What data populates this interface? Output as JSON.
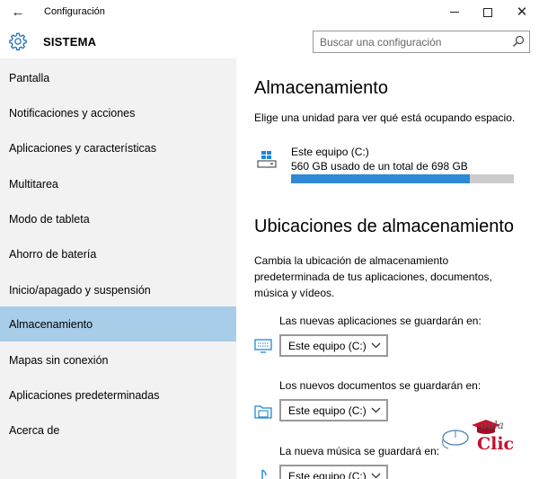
{
  "window": {
    "title": "Configuración"
  },
  "header": {
    "section_title": "SISTEMA",
    "search_placeholder": "Buscar una configuración"
  },
  "sidebar": {
    "items": [
      {
        "label": "Pantalla",
        "active": false
      },
      {
        "label": "Notificaciones y acciones",
        "active": false
      },
      {
        "label": "Aplicaciones y características",
        "active": false
      },
      {
        "label": "Multitarea",
        "active": false
      },
      {
        "label": "Modo de tableta",
        "active": false
      },
      {
        "label": "Ahorro de batería",
        "active": false
      },
      {
        "label": "Inicio/apagado y suspensión",
        "active": false
      },
      {
        "label": "Almacenamiento",
        "active": true
      },
      {
        "label": "Mapas sin conexión",
        "active": false
      },
      {
        "label": "Aplicaciones predeterminadas",
        "active": false
      },
      {
        "label": "Acerca de",
        "active": false
      }
    ]
  },
  "main": {
    "title": "Almacenamiento",
    "description": "Elige una unidad para ver qué está ocupando espacio.",
    "drive": {
      "name": "Este equipo (C:)",
      "usage_text": "560 GB usado de un total de 698 GB",
      "used_gb": 560,
      "total_gb": 698
    },
    "locations_title": "Ubicaciones de almacenamiento",
    "locations_description": "Cambia la ubicación de almacenamiento predeterminada de tus aplicaciones, documentos, música y vídeos.",
    "locations": [
      {
        "label": "Las nuevas aplicaciones se guardarán en:",
        "value": "Este equipo (C:)",
        "icon": "monitor-icon"
      },
      {
        "label": "Los nuevos documentos se guardarán en:",
        "value": "Este equipo (C:)",
        "icon": "folder-icon"
      },
      {
        "label": "La nueva música se guardará en:",
        "value": "Este equipo (C:)",
        "icon": "music-note-icon"
      }
    ]
  },
  "watermark": {
    "text_top": "aula",
    "text_bottom": "Clic"
  },
  "colors": {
    "accent": "#2f89d6",
    "selection": "#a8cde9",
    "sidebar_bg": "#f2f2f2",
    "bar_bg": "#cccccc"
  }
}
